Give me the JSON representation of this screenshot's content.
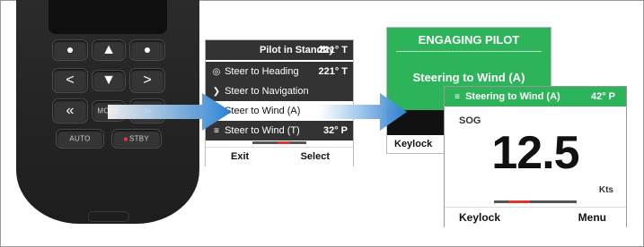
{
  "remote": {
    "buttons": {
      "mode": "MODE",
      "auto": "AUTO",
      "stby": "STBY"
    },
    "icons": [
      "dot-icon",
      "arrow-up-icon",
      "arrow-down-icon",
      "arrow-left-icon",
      "arrow-right-icon",
      "double-left-icon",
      "double-right-icon"
    ]
  },
  "pilot_menu": {
    "title": "Pilot in Standby",
    "heading": "221° T",
    "items": [
      {
        "label": "Steer to Heading",
        "value": "221° T",
        "icon": "compass-icon"
      },
      {
        "label": "Steer to Navigation",
        "value": "",
        "icon": "navigation-icon"
      },
      {
        "label": "Steer to Wind (A)",
        "value": "",
        "icon": "wind-icon"
      },
      {
        "label": "Steer to Wind (T)",
        "value": "32° P",
        "icon": "wind-icon"
      }
    ],
    "footer": {
      "left": "Exit",
      "right": "Select"
    }
  },
  "engaging": {
    "title": "ENGAGING PILOT",
    "message": "Steering to Wind (A)",
    "footer_left": "Keylock"
  },
  "wind_screen": {
    "header_label": "Steering to Wind (A)",
    "header_value": "42° P",
    "sog_label": "SOG",
    "sog_value": "12.5",
    "unit": "Kts",
    "footer": {
      "left": "Keylock",
      "right": "Menu"
    }
  },
  "colors": {
    "accent_green": "#2db35a",
    "arrow_blue": "#2a7fd0",
    "indicator_red": "#e0352b"
  }
}
